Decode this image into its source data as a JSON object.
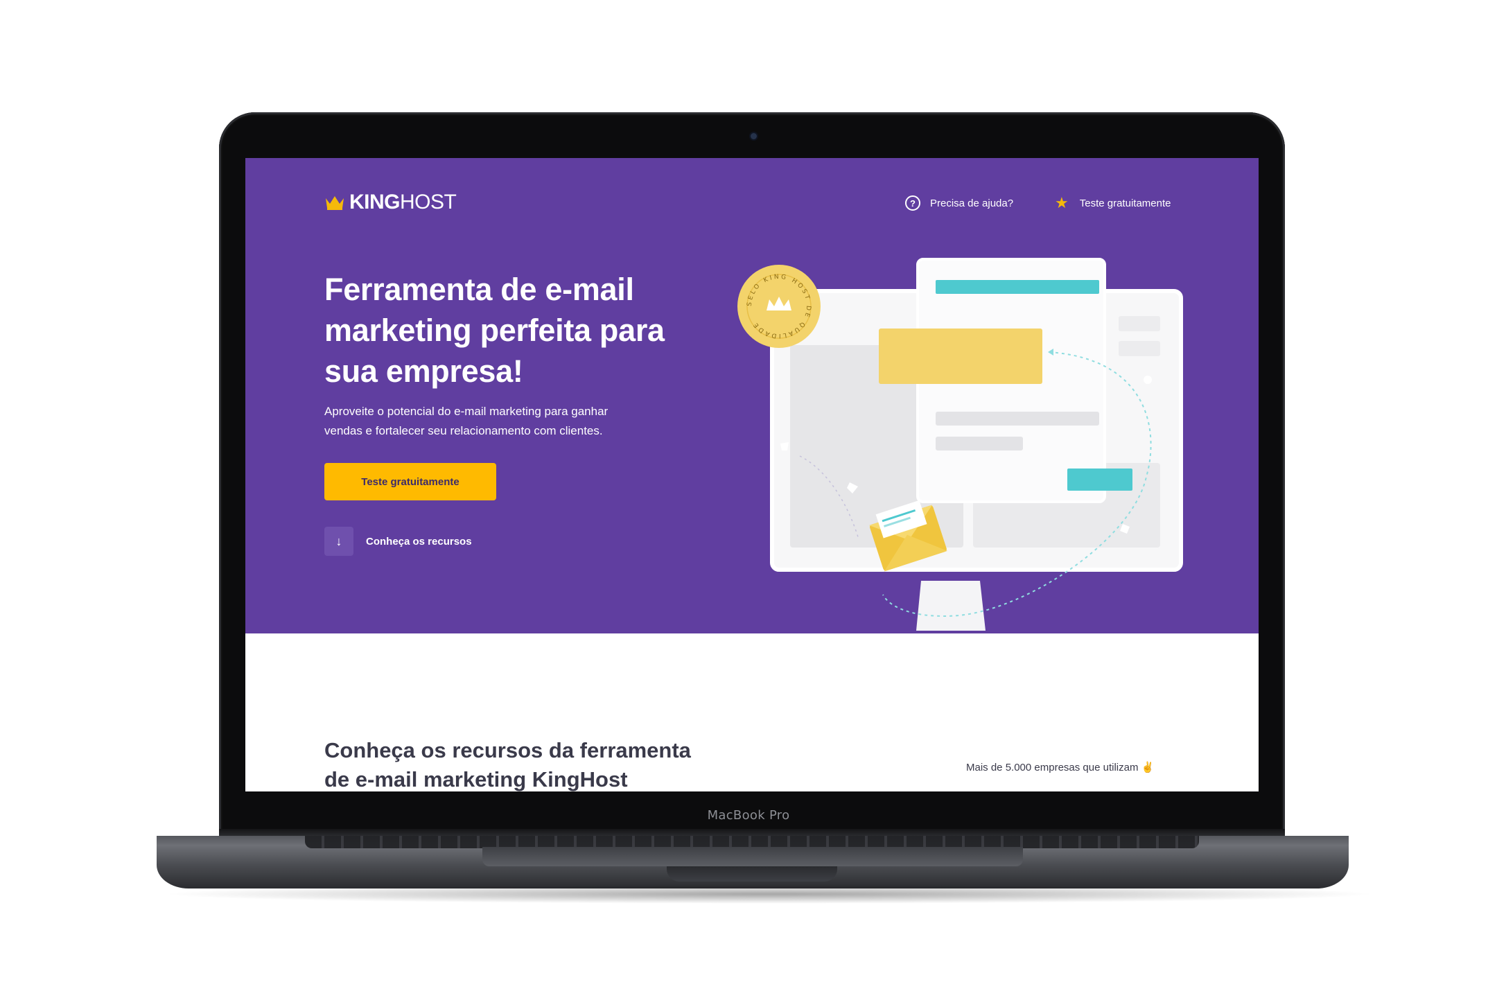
{
  "device": {
    "model": "MacBook Pro"
  },
  "header": {
    "logo": {
      "bold": "KING",
      "light": "HOST",
      "icon": "crown-icon"
    },
    "help_link": {
      "label": "Precisa de ajuda?",
      "icon": "help-circle-icon"
    },
    "trial_link": {
      "label": "Teste gratuitamente",
      "icon": "star-icon"
    }
  },
  "hero": {
    "headline": "Ferramenta de e-mail marketing perfeita para sua empresa!",
    "subtext": "Aproveite o potencial do e-mail marketing para ganhar vendas e fortalecer seu relacionamento com clientes.",
    "cta_label": "Teste gratuitamente",
    "learn_more_label": "Conheça os recursos",
    "learn_more_icon": "arrow-down-icon",
    "seal_text": "SELO KING HOST DE QUALIDADE"
  },
  "features": {
    "title": "Conheça os recursos da ferramenta de e-mail marketing KingHost",
    "stat": "Mais de 5.000 empresas que utilizam ✌"
  },
  "colors": {
    "hero_bg": "#603ea0",
    "cta_bg": "#ffba00",
    "accent_teal": "#4ec9cf",
    "accent_yellow": "#f3d36b",
    "star": "#f5b90a"
  }
}
